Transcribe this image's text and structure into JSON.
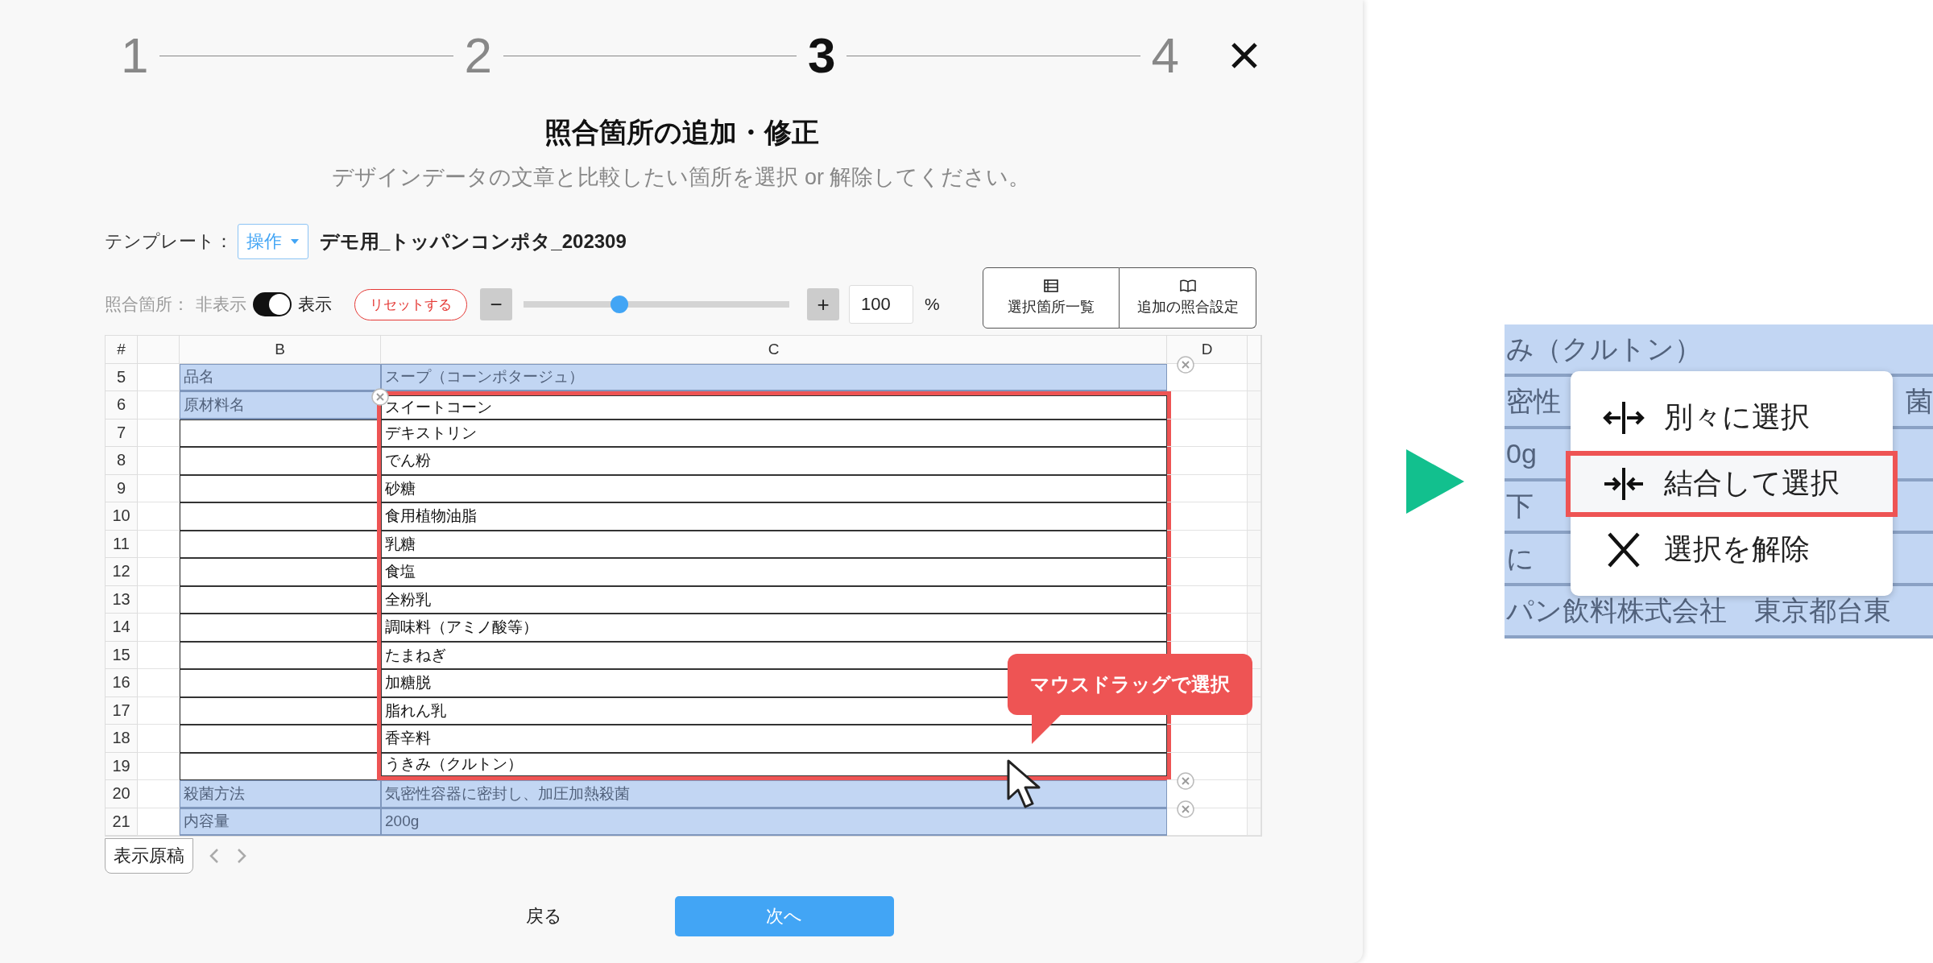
{
  "steps": [
    {
      "label": "1",
      "selected": false
    },
    {
      "label": "2",
      "selected": false
    },
    {
      "label": "3",
      "selected": true
    },
    {
      "label": "4",
      "selected": false
    }
  ],
  "title": "照合箇所の追加・修正",
  "subtitle": "デザインデータの文章と比較したい箇所を選択 or 解除してください。",
  "template": {
    "label": "テンプレート：",
    "dropdown": "操作",
    "name": "デモ用_トッパンコンポタ_202309"
  },
  "toolbar": {
    "label": "照合箇所：",
    "off_label": "非表示",
    "on_label": "表示",
    "toggle_on": true,
    "reset": "リセットする",
    "minus": "−",
    "plus": "+",
    "zoom": {
      "level": 0.35
    },
    "zoom_value": "100",
    "unit": "%"
  },
  "actions": [
    {
      "kind": "list",
      "label": "選択箇所一覧"
    },
    {
      "kind": "book",
      "label": "追加の照合設定"
    }
  ],
  "table": {
    "columns": [
      "#",
      "",
      "B",
      "C",
      "D"
    ],
    "rows": [
      {
        "num": "5",
        "b": {
          "text": "品名",
          "kind": "highlighted"
        },
        "c": {
          "text": "スープ（コーンポタージュ）",
          "kind": "highlighted"
        },
        "dragged": false,
        "remove_left": false,
        "remove_right": true
      },
      {
        "num": "6",
        "b": {
          "text": "原材料名",
          "kind": "highlighted"
        },
        "c": {
          "text": "スイートコーン",
          "kind": "outlined"
        },
        "dragged": true,
        "remove_left": true,
        "remove_right": false
      },
      {
        "num": "7",
        "b": {
          "kind": "outlined"
        },
        "c": {
          "text": "デキストリン",
          "kind": "outlined"
        },
        "dragged": true,
        "remove_left": false,
        "remove_right": false
      },
      {
        "num": "8",
        "b": {
          "kind": "outlined"
        },
        "c": {
          "text": "でん粉",
          "kind": "outlined"
        },
        "dragged": true,
        "remove_left": false,
        "remove_right": false
      },
      {
        "num": "9",
        "b": {
          "kind": "outlined"
        },
        "c": {
          "text": "砂糖",
          "kind": "outlined"
        },
        "dragged": true,
        "remove_left": false,
        "remove_right": false
      },
      {
        "num": "10",
        "b": {
          "kind": "outlined"
        },
        "c": {
          "text": "食用植物油脂",
          "kind": "outlined"
        },
        "dragged": true,
        "remove_left": false,
        "remove_right": false
      },
      {
        "num": "11",
        "b": {
          "kind": "outlined"
        },
        "c": {
          "text": "乳糖",
          "kind": "outlined"
        },
        "dragged": true,
        "remove_left": false,
        "remove_right": false
      },
      {
        "num": "12",
        "b": {
          "kind": "outlined"
        },
        "c": {
          "text": "食塩",
          "kind": "outlined"
        },
        "dragged": true,
        "remove_left": false,
        "remove_right": false
      },
      {
        "num": "13",
        "b": {
          "kind": "outlined"
        },
        "c": {
          "text": "全粉乳",
          "kind": "outlined"
        },
        "dragged": true,
        "remove_left": false,
        "remove_right": false
      },
      {
        "num": "14",
        "b": {
          "kind": "outlined"
        },
        "c": {
          "text": "調味料（アミノ酸等）",
          "kind": "outlined"
        },
        "dragged": true,
        "remove_left": false,
        "remove_right": false
      },
      {
        "num": "15",
        "b": {
          "kind": "outlined"
        },
        "c": {
          "text": "たまねぎ",
          "kind": "outlined"
        },
        "dragged": true,
        "remove_left": false,
        "remove_right": false
      },
      {
        "num": "16",
        "b": {
          "kind": "outlined"
        },
        "c": {
          "text": "加糖脱",
          "kind": "outlined"
        },
        "dragged": true,
        "remove_left": false,
        "remove_right": false
      },
      {
        "num": "17",
        "b": {
          "kind": "outlined"
        },
        "c": {
          "text": "脂れん乳",
          "kind": "outlined"
        },
        "dragged": true,
        "remove_left": false,
        "remove_right": false
      },
      {
        "num": "18",
        "b": {
          "kind": "outlined"
        },
        "c": {
          "text": "香辛料",
          "kind": "outlined"
        },
        "dragged": true,
        "remove_left": false,
        "remove_right": false
      },
      {
        "num": "19",
        "b": {
          "kind": "outlined"
        },
        "c": {
          "text": "うきみ（クルトン）",
          "kind": "outlined"
        },
        "dragged": true,
        "remove_left": false,
        "remove_right": false
      },
      {
        "num": "20",
        "b": {
          "text": "殺菌方法",
          "kind": "highlighted"
        },
        "c": {
          "text": "気密性容器に密封し、加圧加熱殺菌",
          "kind": "highlighted"
        },
        "dragged": false,
        "remove_left": false,
        "remove_right": true
      },
      {
        "num": "21",
        "b": {
          "text": "内容量",
          "kind": "highlighted"
        },
        "c": {
          "text": "200g",
          "kind": "highlighted"
        },
        "dragged": false,
        "remove_left": false,
        "remove_right": true
      }
    ]
  },
  "tooltip": "マウスドラッグで選択",
  "sheet_tab": "表示原稿",
  "back": "戻る",
  "next": "次へ",
  "zoom_panel": {
    "rows": [
      {
        "left": "み（クルトン）"
      },
      {
        "left": "密性",
        "right": "菌"
      },
      {
        "left": "0g"
      },
      {
        "left": "下"
      },
      {
        "left": "に"
      },
      {
        "left": "パン飲料株式会社　東京都台東"
      }
    ],
    "menu": [
      {
        "kind": "split",
        "label": "別々に選択",
        "selected": false
      },
      {
        "kind": "merge",
        "label": "結合して選択",
        "selected": true
      },
      {
        "kind": "clear",
        "label": "選択を解除",
        "selected": false
      }
    ]
  }
}
